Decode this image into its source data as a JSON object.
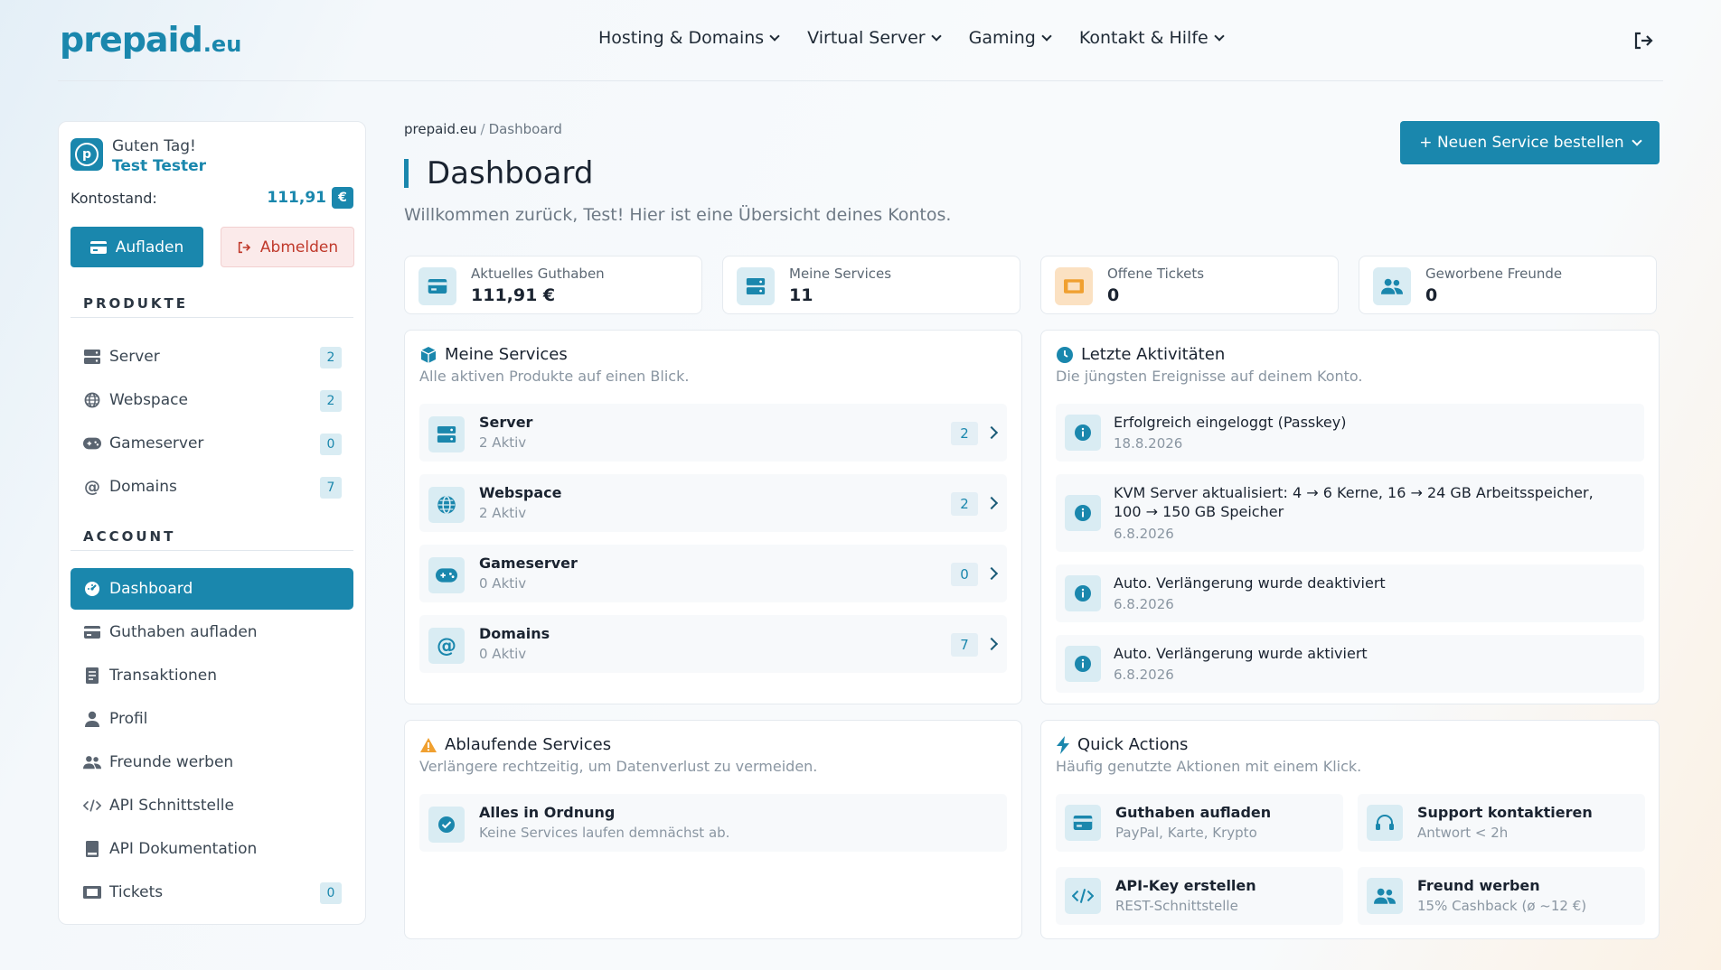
{
  "brand": {
    "name": "prepaid",
    "tld": ".eu",
    "color": "#1a87ad"
  },
  "nav": [
    {
      "label": "Hosting & Domains"
    },
    {
      "label": "Virtual Server"
    },
    {
      "label": "Gaming"
    },
    {
      "label": "Kontakt & Hilfe"
    }
  ],
  "user": {
    "greeting": "Guten Tag!",
    "name": "Test Tester",
    "balance_label": "Kontostand:",
    "balance": "111,91",
    "currency": "€",
    "topup_label": "Aufladen",
    "logout_label": "Abmelden"
  },
  "sidebar": {
    "products_title": "PRODUKTE",
    "products": [
      {
        "label": "Server",
        "count": "2",
        "icon": "server-icon"
      },
      {
        "label": "Webspace",
        "count": "2",
        "icon": "globe-icon"
      },
      {
        "label": "Gameserver",
        "count": "0",
        "icon": "gamepad-icon"
      },
      {
        "label": "Domains",
        "count": "7",
        "icon": "at-icon"
      }
    ],
    "account_title": "ACCOUNT",
    "account": [
      {
        "label": "Dashboard",
        "icon": "dashboard-icon"
      },
      {
        "label": "Guthaben aufladen",
        "icon": "card-icon"
      },
      {
        "label": "Transaktionen",
        "icon": "receipt-icon"
      },
      {
        "label": "Profil",
        "icon": "user-icon"
      },
      {
        "label": "Freunde werben",
        "icon": "users-icon"
      },
      {
        "label": "API Schnittstelle",
        "icon": "code-icon"
      },
      {
        "label": "API Dokumentation",
        "icon": "book-icon"
      },
      {
        "label": "Tickets",
        "count": "0",
        "icon": "ticket-icon"
      }
    ]
  },
  "breadcrumb": {
    "root": "prepaid.eu",
    "separator": "/",
    "current": "Dashboard"
  },
  "page": {
    "title": "Dashboard",
    "subtitle": "Willkommen zurück, Test! Hier ist eine Übersicht deines Kontos.",
    "order_button": "+ Neuen Service bestellen"
  },
  "stats": [
    {
      "label": "Aktuelles Guthaben",
      "value": "111,91 €",
      "icon": "card-icon"
    },
    {
      "label": "Meine Services",
      "value": "11",
      "icon": "server-icon"
    },
    {
      "label": "Offene Tickets",
      "value": "0",
      "icon": "ticket-icon"
    },
    {
      "label": "Geworbene Freunde",
      "value": "0",
      "icon": "users-icon"
    }
  ],
  "services": {
    "title": "Meine Services",
    "subtitle": "Alle aktiven Produkte auf einen Blick.",
    "items": [
      {
        "name": "Server",
        "status": "2 Aktiv",
        "count": "2",
        "icon": "server-icon"
      },
      {
        "name": "Webspace",
        "status": "2 Aktiv",
        "count": "2",
        "icon": "globe-icon"
      },
      {
        "name": "Gameserver",
        "status": "0 Aktiv",
        "count": "0",
        "icon": "gamepad-icon"
      },
      {
        "name": "Domains",
        "status": "0 Aktiv",
        "count": "7",
        "icon": "at-icon"
      }
    ]
  },
  "activities": {
    "title": "Letzte Aktivitäten",
    "subtitle": "Die jüngsten Ereignisse auf deinem Konto.",
    "items": [
      {
        "text": "Erfolgreich eingeloggt (Passkey)",
        "date": "18.8.2026"
      },
      {
        "text": "KVM Server aktualisiert: 4 → 6 Kerne, 16 → 24 GB Arbeitsspeicher, 100 → 150 GB Speicher",
        "date": "6.8.2026"
      },
      {
        "text": "Auto. Verlängerung wurde deaktiviert",
        "date": "6.8.2026"
      },
      {
        "text": "Auto. Verlängerung wurde aktiviert",
        "date": "6.8.2026"
      }
    ]
  },
  "expiring": {
    "title": "Ablaufende Services",
    "subtitle": "Verlängere rechtzeitig, um Datenverlust zu vermeiden.",
    "status_title": "Alles in Ordnung",
    "status_sub": "Keine Services laufen demnächst ab."
  },
  "quick": {
    "title": "Quick Actions",
    "subtitle": "Häufig genutzte Aktionen mit einem Klick.",
    "items": [
      {
        "title": "Guthaben aufladen",
        "sub": "PayPal, Karte, Krypto",
        "icon": "card-icon"
      },
      {
        "title": "Support kontaktieren",
        "sub": "Antwort < 2h",
        "icon": "headset-icon"
      },
      {
        "title": "API-Key erstellen",
        "sub": "REST-Schnittstelle",
        "icon": "code-icon"
      },
      {
        "title": "Freund werben",
        "sub": "15% Cashback (ø ~12 €)",
        "icon": "users-icon"
      }
    ]
  }
}
